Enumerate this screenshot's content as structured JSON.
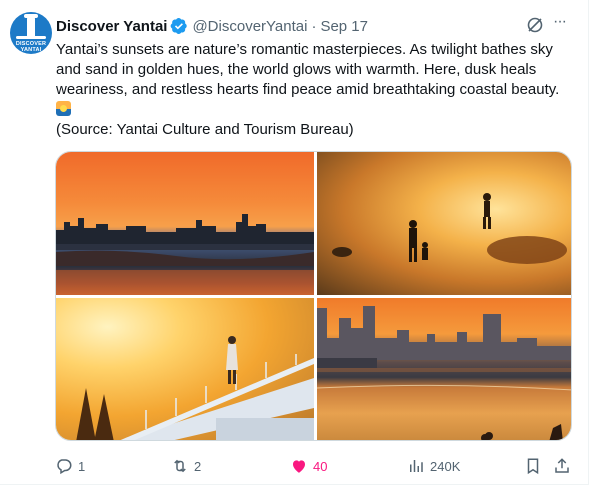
{
  "post": {
    "avatar_text": "DISCOVER YANTAI",
    "display_name": "Discover Yantai",
    "handle": "@DiscoverYantai",
    "separator": "·",
    "date": "Sep 17",
    "more_label": "···",
    "text": "Yantai’s sunsets are nature’s romantic masterpieces. As twilight bathes sky and sand in golden hues, the world glows with warmth. Here, dusk heals weariness, and restless hearts find peace amid breathtaking coastal beauty. ",
    "source": "(Source: Yantai Culture and Tourism Bureau)",
    "emoji": "sunrise-over-sea-emoji"
  },
  "media": {
    "photos": [
      "sunset-beach-skyline",
      "silhouettes-on-golden-shore",
      "woman-on-pier-at-sunset",
      "city-skyline-over-golden-sea"
    ]
  },
  "actions": {
    "replies": "1",
    "reposts": "2",
    "likes": "40",
    "views": "240K"
  },
  "colors": {
    "text": "#0f1419",
    "secondary": "#536471",
    "verified": "#1d9bf0",
    "like": "#f91880",
    "border": "#cfd9de"
  },
  "icons": [
    "verified-badge-icon",
    "grok-icon",
    "more-icon",
    "reply-icon",
    "repost-icon",
    "like-icon",
    "views-icon",
    "bookmark-icon",
    "share-icon"
  ]
}
